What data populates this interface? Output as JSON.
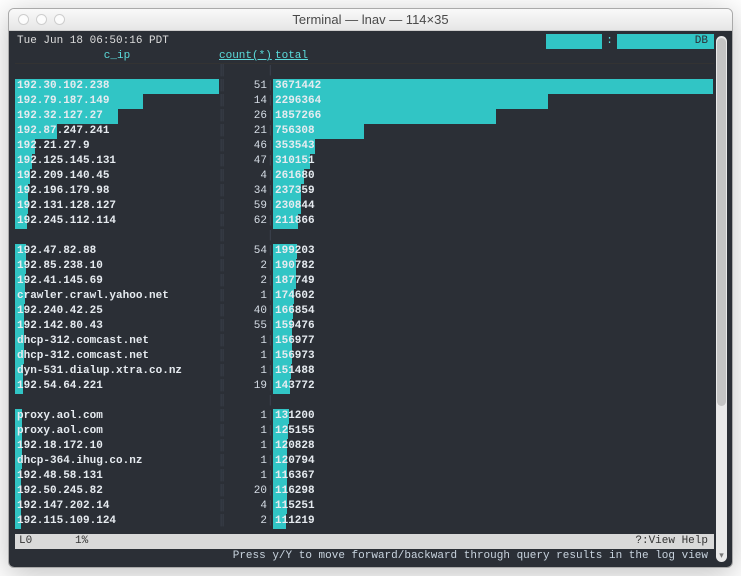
{
  "window": {
    "title": "Terminal — lnav — 114×35"
  },
  "top": {
    "datetime": "Tue Jun 18 06:50:16 PDT",
    "seg1": "",
    "seg2": ":",
    "seg3": "",
    "seg4": "DB"
  },
  "headers": {
    "col1": "c_ip",
    "col2": "count(*)",
    "col3": "total"
  },
  "max_total": 3671442,
  "max_cip_bar": 204,
  "rows": [
    {
      "gap": true
    },
    {
      "cip": "192.30.102.238",
      "cnt": "51",
      "total": 3671442
    },
    {
      "cip": "192.79.187.149",
      "cnt": "14",
      "total": 2296364
    },
    {
      "cip": "192.32.127.27",
      "cnt": "26",
      "total": 1857266
    },
    {
      "cip": "192.87.247.241",
      "cnt": "21",
      "total": 756308
    },
    {
      "cip": "192.21.27.9",
      "cnt": "46",
      "total": 353543
    },
    {
      "cip": "192.125.145.131",
      "cnt": "47",
      "total": 310151
    },
    {
      "cip": "192.209.140.45",
      "cnt": "4",
      "total": 261680
    },
    {
      "cip": "192.196.179.98",
      "cnt": "34",
      "total": 237359
    },
    {
      "cip": "192.131.128.127",
      "cnt": "59",
      "total": 230844
    },
    {
      "cip": "192.245.112.114",
      "cnt": "62",
      "total": 211866
    },
    {
      "gap": true
    },
    {
      "cip": "192.47.82.88",
      "cnt": "54",
      "total": 199203
    },
    {
      "cip": "192.85.238.10",
      "cnt": "2",
      "total": 190782
    },
    {
      "cip": "192.41.145.69",
      "cnt": "2",
      "total": 187749
    },
    {
      "cip": "crawler.crawl.yahoo.net",
      "cnt": "1",
      "total": 174602
    },
    {
      "cip": "192.240.42.25",
      "cnt": "40",
      "total": 166854
    },
    {
      "cip": "192.142.80.43",
      "cnt": "55",
      "total": 159476
    },
    {
      "cip": "dhcp-312.comcast.net",
      "cnt": "1",
      "total": 156977
    },
    {
      "cip": "dhcp-312.comcast.net",
      "cnt": "1",
      "total": 156973
    },
    {
      "cip": "dyn-531.dialup.xtra.co.nz",
      "cnt": "1",
      "total": 151488
    },
    {
      "cip": "192.54.64.221",
      "cnt": "19",
      "total": 143772
    },
    {
      "gap": true
    },
    {
      "cip": "proxy.aol.com",
      "cnt": "1",
      "total": 131200
    },
    {
      "cip": "proxy.aol.com",
      "cnt": "1",
      "total": 125155
    },
    {
      "cip": "192.18.172.10",
      "cnt": "1",
      "total": 120828
    },
    {
      "cip": "dhcp-364.ihug.co.nz",
      "cnt": "1",
      "total": 120794
    },
    {
      "cip": "192.48.58.131",
      "cnt": "1",
      "total": 116367
    },
    {
      "cip": "192.50.245.82",
      "cnt": "20",
      "total": 116298
    },
    {
      "cip": "192.147.202.14",
      "cnt": "4",
      "total": 115251
    },
    {
      "cip": "192.115.109.124",
      "cnt": "2",
      "total": 111219
    }
  ],
  "footer": {
    "left1": "L0",
    "left2": "1%",
    "right": "?:View Help"
  },
  "footer2": "Press y/Y to move forward/backward through query results in the log view"
}
